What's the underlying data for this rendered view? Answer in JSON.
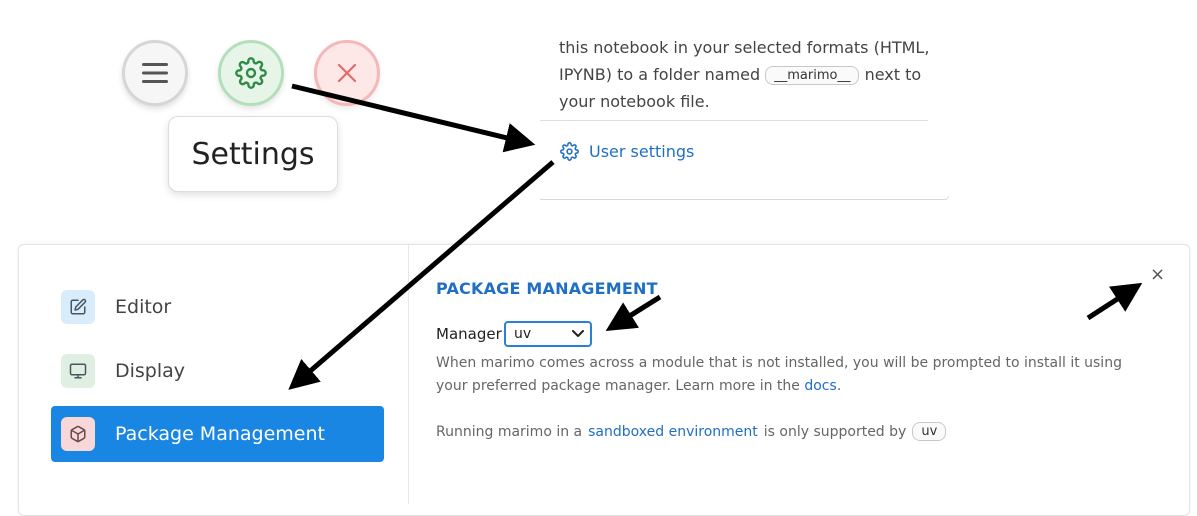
{
  "toolbar": {
    "menu_icon": "hamburger-icon",
    "settings_icon": "gear-icon",
    "close_icon": "close-icon",
    "tooltip": "Settings"
  },
  "export_popover": {
    "line1": "this notebook in your selected formats (HTML,",
    "line2_pre": "IPYNB) to a folder named",
    "folder_chip": "__marimo__",
    "line2_post": "next to",
    "line3": "your notebook file.",
    "user_settings_link": "User settings"
  },
  "settings_dialog": {
    "sidebar": {
      "items": [
        {
          "label": "Editor",
          "icon": "edit-icon"
        },
        {
          "label": "Display",
          "icon": "monitor-icon"
        },
        {
          "label": "Package Management",
          "icon": "package-icon",
          "active": true
        }
      ]
    },
    "section_title": "PACKAGE MANAGEMENT",
    "manager_label": "Manager",
    "manager_value": "uv",
    "help_text_pre": "When marimo comes across a module that is not installed, you will be prompted to install it using your preferred package manager. Learn more in the",
    "help_link": "docs",
    "help_text_post": ".",
    "sandbox_pre": "Running marimo in a",
    "sandbox_link": "sandboxed environment",
    "sandbox_mid": "is only supported by",
    "sandbox_chip": "uv",
    "close_label": "×"
  },
  "colors": {
    "accent": "#1a86e4",
    "link": "#1f6fc5",
    "arrow": "#000000"
  }
}
